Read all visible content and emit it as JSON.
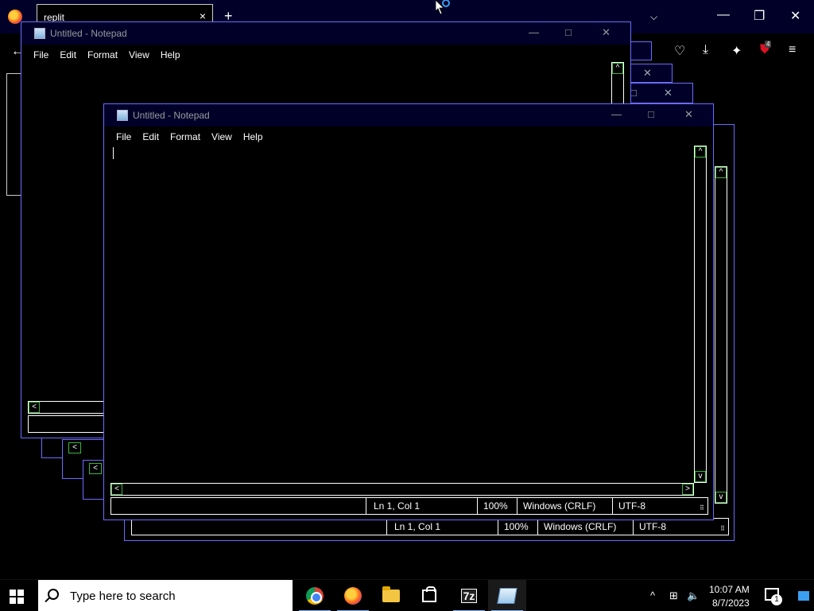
{
  "browser": {
    "tab_label": "replit",
    "tab_close": "×",
    "new_tab": "+",
    "tab_list": "⌵",
    "minimize": "—",
    "restore": "❐",
    "close": "✕",
    "back": "←",
    "toolbar_icons": [
      "pocket-icon",
      "download-icon",
      "extensions-icon",
      "ublock-icon",
      "menu-icon"
    ],
    "extension_badge": "4"
  },
  "notepad_back": {
    "title": "Untitled - Notepad",
    "menu": [
      "File",
      "Edit",
      "Format",
      "View",
      "Help"
    ]
  },
  "notepad_front": {
    "title": "Untitled - Notepad",
    "menu": [
      "File",
      "Edit",
      "Format",
      "View",
      "Help"
    ],
    "status": {
      "position": "Ln 1, Col 1",
      "zoom": "100%",
      "line_ending": "Windows (CRLF)",
      "encoding": "UTF-8"
    }
  },
  "notepad_shadow": {
    "status": {
      "position": "Ln 1, Col 1",
      "zoom": "100%",
      "line_ending": "Windows (CRLF)",
      "encoding": "UTF-8"
    }
  },
  "taskbar": {
    "search_placeholder": "Type here to search",
    "apps": [
      "Google Chrome",
      "Firefox",
      "File Explorer",
      "Microsoft Store",
      "7-Zip",
      "Notepad"
    ],
    "sevenzip_label": "7z",
    "time": "10:07 AM",
    "date": "8/7/2023",
    "notification_count": "1"
  },
  "colors": {
    "window_border": "#6b6bff",
    "titlebar": "#000028",
    "scroll_arrow_border": "#3cb43c",
    "search_box": "#ffffff"
  }
}
